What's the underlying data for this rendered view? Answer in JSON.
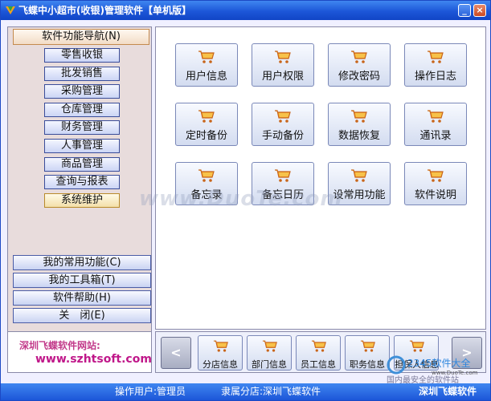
{
  "window": {
    "title": "飞蝶中小超市(收银)管理软件【单机版】"
  },
  "nav": {
    "header": "软件功能导航(N)",
    "items": [
      "零售收银",
      "批发销售",
      "采购管理",
      "仓库管理",
      "财务管理",
      "人事管理",
      "商品管理",
      "查询与报表",
      "系统维护"
    ],
    "active_index": 8
  },
  "lower_buttons": [
    "我的常用功能(C)",
    "我的工具箱(T)",
    "软件帮助(H)",
    "关　闭(E)"
  ],
  "website": {
    "label": "深圳飞蝶软件网站:",
    "url": "www.szhtsoft.com"
  },
  "tiles": [
    "用户信息",
    "用户权限",
    "修改密码",
    "操作日志",
    "定时备份",
    "手动备份",
    "数据恢复",
    "通讯录",
    "备忘录",
    "备忘日历",
    "设常用功能",
    "软件说明"
  ],
  "shortcuts": [
    "分店信息",
    "部门信息",
    "员工信息",
    "职务信息",
    "担保人信息"
  ],
  "status": {
    "operator": "操作用户:管理员",
    "branch": "隶属分店:深圳飞蝶软件",
    "brand": "深圳飞蝶软件"
  },
  "watermark": "www.DuoTe.com",
  "corner_logo": {
    "text": "2345软件大全",
    "sub": "国内最安全的软件站",
    "site": "www.DuoTe.com"
  },
  "colors": {
    "titlebar": "#1c56d8",
    "accent": "#e8791e",
    "link": "#c0188a"
  },
  "icons": {
    "tile": "shopping-cart-icon",
    "prev": "chevron-left-icon",
    "next": "chevron-right-icon"
  }
}
